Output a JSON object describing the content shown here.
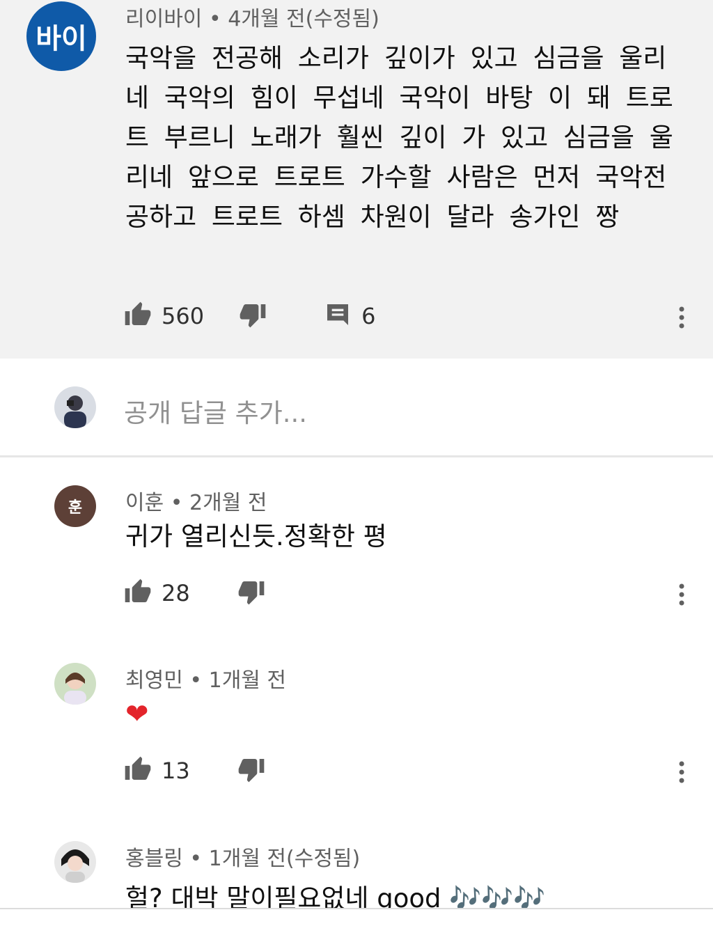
{
  "comments": [
    {
      "author": "리이바이",
      "avatar_text": "바이",
      "time": "4개월 전(수정됨)",
      "text": "국악을 전공해 소리가 깊이가 있고 심금을 울리네 국악의 힘이 무섭네 국악이 바탕 이 돼 트로트 부르니 노래가 훨씬 깊이 가 있고 심금을 울 리네 앞으로 트로트 가수할 사람은 먼저 국악전공하고 트로트 하셈 차원이 달라 송가인 짱",
      "likes": "560",
      "replies": "6"
    },
    {
      "author": "이훈",
      "avatar_text": "훈",
      "time": "2개월 전",
      "text": "귀가 열리신듯.정확한 평",
      "likes": "28"
    },
    {
      "author": "최영민",
      "time": "1개월 전",
      "text": "❤",
      "likes": "13"
    },
    {
      "author": "홍블링",
      "time": "1개월 전(수정됨)",
      "text": "헐? 대박 말이필요없네 good 🎶🎶🎶"
    }
  ],
  "reply_box": {
    "placeholder": "공개 답글 추가..."
  },
  "separator": "•",
  "colors": {
    "avatar_blue": "#0f5aa8",
    "avatar_brown": "#5d4037",
    "heart": "#e3242b"
  }
}
